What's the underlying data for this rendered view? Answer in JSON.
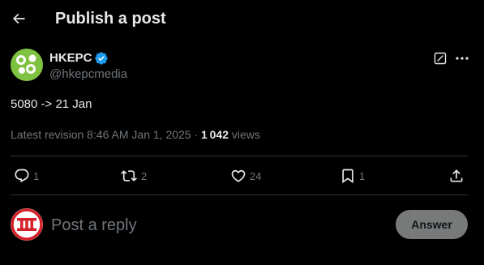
{
  "header": {
    "title": "Publish a post",
    "back_icon": "arrow-left-icon"
  },
  "post": {
    "author_name": "HKEPC",
    "author_handle": "@hkepcmedia",
    "verified": true,
    "verified_color": "#1d9bf0",
    "text": "5080 -> 21 Jan",
    "meta_prefix": "Latest revision 8:46 AM Jan 1, 2025 · ",
    "views_count": "1 042",
    "views_suffix": " views"
  },
  "actions": {
    "reply": {
      "icon": "reply-icon",
      "count": "1"
    },
    "repost": {
      "icon": "repost-icon",
      "count": "2"
    },
    "like": {
      "icon": "heart-icon",
      "count": "24"
    },
    "bookmark": {
      "icon": "bookmark-icon",
      "count": "1"
    },
    "share": {
      "icon": "share-icon"
    }
  },
  "reply_box": {
    "placeholder": "Post a reply",
    "button_label": "Answer"
  },
  "colors": {
    "background": "#000000",
    "text_primary": "#e7e9ea",
    "text_secondary": "#71767b",
    "divider": "#2f3336",
    "avatar_green": "#7fc241",
    "reply_avatar_red": "#d6202a",
    "button_disabled": "#787a7a"
  }
}
